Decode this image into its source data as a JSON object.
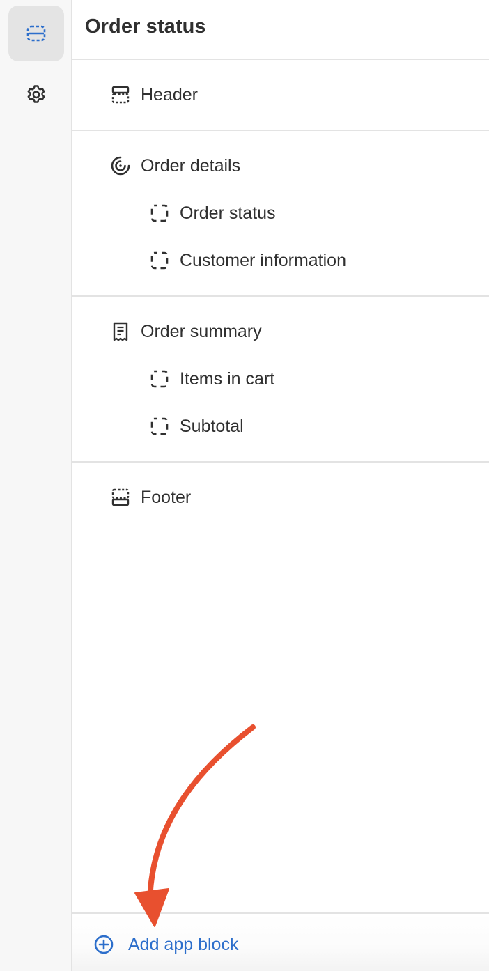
{
  "rail": {
    "items": [
      {
        "icon": "sections-icon",
        "active": true
      },
      {
        "icon": "gear-icon",
        "active": false
      }
    ]
  },
  "panel": {
    "title": "Order status",
    "groups": [
      {
        "section": {
          "label": "Header",
          "icon": "header-layout-icon"
        },
        "blocks": []
      },
      {
        "section": {
          "label": "Order details",
          "icon": "order-details-icon"
        },
        "blocks": [
          {
            "label": "Order status",
            "icon": "block-icon"
          },
          {
            "label": "Customer information",
            "icon": "block-icon"
          }
        ]
      },
      {
        "section": {
          "label": "Order summary",
          "icon": "receipt-icon"
        },
        "blocks": [
          {
            "label": "Items in cart",
            "icon": "block-icon"
          },
          {
            "label": "Subtotal",
            "icon": "block-icon"
          }
        ]
      },
      {
        "section": {
          "label": "Footer",
          "icon": "footer-layout-icon"
        },
        "blocks": []
      }
    ]
  },
  "bottom": {
    "add_label": "Add app block",
    "icon": "plus-circle-icon"
  },
  "colors": {
    "accent": "#2c6ecb",
    "arrow": "#e8502f",
    "text": "#303030",
    "divider": "#e3e3e3"
  }
}
